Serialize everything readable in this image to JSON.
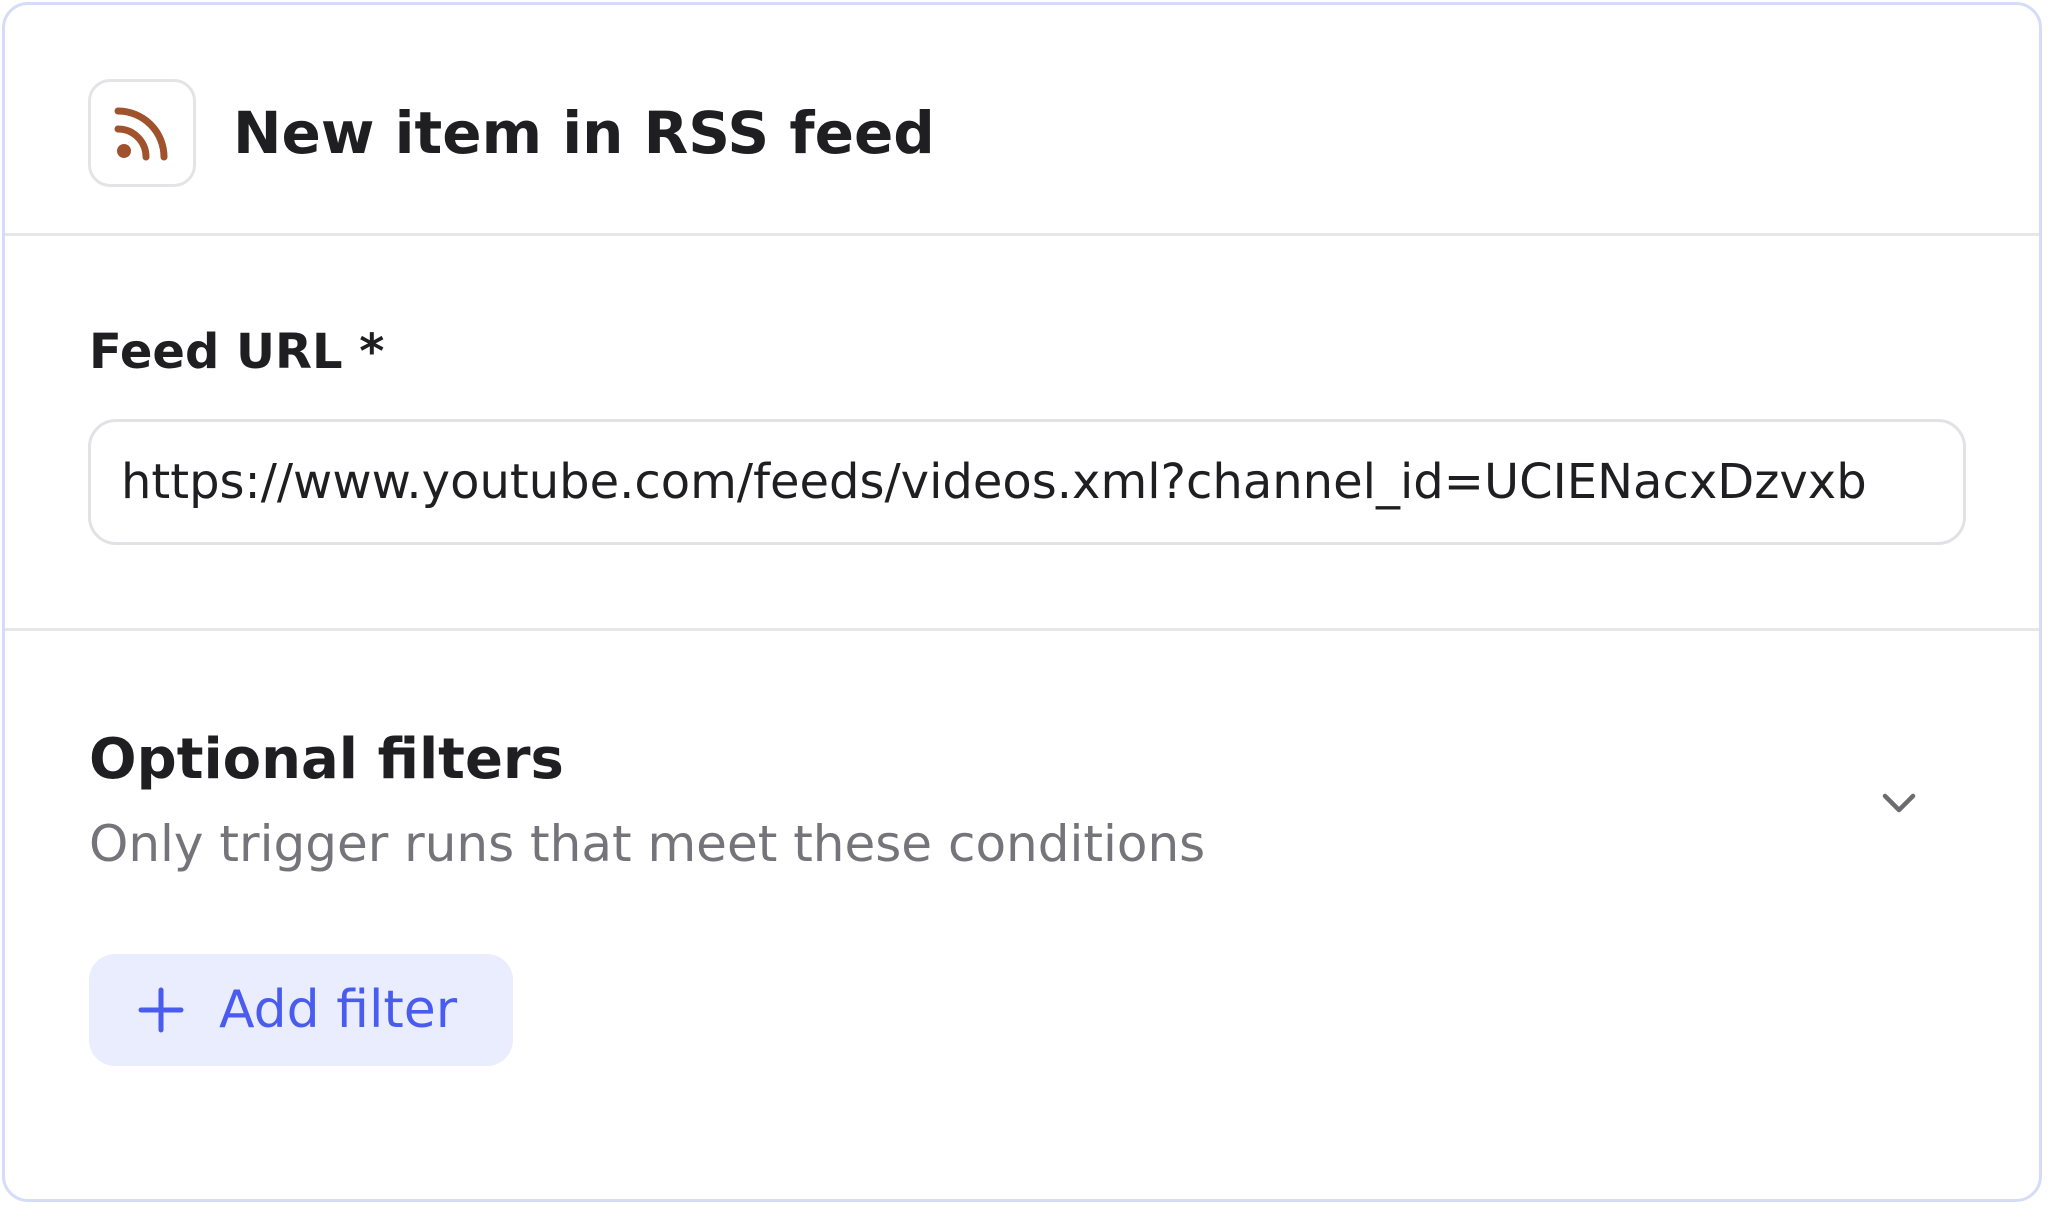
{
  "header": {
    "icon": "rss-icon",
    "title": "New item in RSS feed"
  },
  "feed_url": {
    "label": "Feed URL *",
    "value": "https://www.youtube.com/feeds/videos.xml?channel_id=UCIENacxDzvxb"
  },
  "filters": {
    "title": "Optional filters",
    "subtitle": "Only trigger runs that meet these conditions",
    "expand_icon": "chevron-down-icon",
    "add_button": {
      "icon": "plus-icon",
      "label": "Add filter"
    }
  },
  "colors": {
    "rss_icon": "#a0522d",
    "accent": "#4a5cf0",
    "accent_bg": "#eaedfd",
    "card_border": "#d6dcf7",
    "muted_text": "#74747a"
  }
}
